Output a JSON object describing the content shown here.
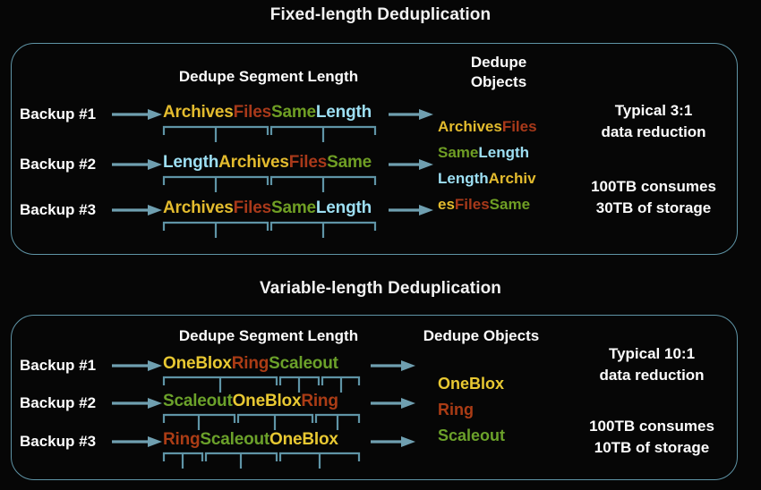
{
  "meta": {
    "accent_border": "#5f94a6",
    "arrow_color": "#6f9fb0",
    "bracket_color": "#5f94a6",
    "background": "#060606",
    "text_color": "#ffffff"
  },
  "panels": [
    {
      "id": "fixed",
      "title": "Fixed-length Deduplication",
      "headers": {
        "segment": "Dedupe Segment Length",
        "objects_line1": "Dedupe",
        "objects_line2": "Objects"
      },
      "rows": [
        {
          "label": "Backup #1",
          "segments": [
            {
              "text": "Archives",
              "color_class": "w-archives"
            },
            {
              "text": "Files",
              "color_class": "w-files"
            },
            {
              "text": "Same",
              "color_class": "w-same"
            },
            {
              "text": "Length",
              "color_class": "w-length"
            }
          ]
        },
        {
          "label": "Backup #2",
          "segments": [
            {
              "text": "Length",
              "color_class": "w-length"
            },
            {
              "text": "Archives",
              "color_class": "w-archives"
            },
            {
              "text": "Files",
              "color_class": "w-files"
            },
            {
              "text": "Same",
              "color_class": "w-same"
            }
          ]
        },
        {
          "label": "Backup #3",
          "segments": [
            {
              "text": "Archives",
              "color_class": "w-archives"
            },
            {
              "text": "Files",
              "color_class": "w-files"
            },
            {
              "text": "Same",
              "color_class": "w-same"
            },
            {
              "text": "Length",
              "color_class": "w-length"
            }
          ]
        }
      ],
      "objects": [
        [
          {
            "text": "Archives",
            "color_class": "w-archives"
          },
          {
            "text": "Files",
            "color_class": "w-files"
          }
        ],
        [
          {
            "text": "Same",
            "color_class": "w-same"
          },
          {
            "text": "Length",
            "color_class": "w-length"
          }
        ],
        [
          {
            "text": "Length",
            "color_class": "w-length"
          },
          {
            "text": "Archiv",
            "color_class": "w-archives"
          }
        ],
        [
          {
            "text": "es",
            "color_class": "w-archives"
          },
          {
            "text": "Files",
            "color_class": "w-files"
          },
          {
            "text": "Same",
            "color_class": "w-same"
          }
        ]
      ],
      "notes": {
        "ratio_line1": "Typical 3:1",
        "ratio_line2": "data reduction",
        "storage_line1": "100TB consumes",
        "storage_line2": "30TB of storage"
      }
    },
    {
      "id": "variable",
      "title": "Variable-length Deduplication",
      "headers": {
        "segment": "Dedupe Segment Length",
        "objects_line1": "Dedupe Objects",
        "objects_line2": ""
      },
      "rows": [
        {
          "label": "Backup #1",
          "segments": [
            {
              "text": "OneBlox",
              "color_class": "w-oneblox"
            },
            {
              "text": "Ring",
              "color_class": "w-ring"
            },
            {
              "text": "Scaleout",
              "color_class": "w-scaleout"
            }
          ]
        },
        {
          "label": "Backup #2",
          "segments": [
            {
              "text": "Scaleout",
              "color_class": "w-scaleout"
            },
            {
              "text": "OneBlox",
              "color_class": "w-oneblox"
            },
            {
              "text": "Ring",
              "color_class": "w-ring"
            }
          ]
        },
        {
          "label": "Backup #3",
          "segments": [
            {
              "text": "Ring",
              "color_class": "w-ring"
            },
            {
              "text": "Scaleout",
              "color_class": "w-scaleout"
            },
            {
              "text": "OneBlox",
              "color_class": "w-oneblox"
            }
          ]
        }
      ],
      "objects": [
        [
          {
            "text": "OneBlox",
            "color_class": "w-oneblox"
          }
        ],
        [
          {
            "text": "Ring",
            "color_class": "w-ring"
          }
        ],
        [
          {
            "text": "Scaleout",
            "color_class": "w-scaleout"
          }
        ]
      ],
      "notes": {
        "ratio_line1": "Typical 10:1",
        "ratio_line2": "data reduction",
        "storage_line1": "100TB consumes",
        "storage_line2": "10TB of storage"
      }
    }
  ]
}
